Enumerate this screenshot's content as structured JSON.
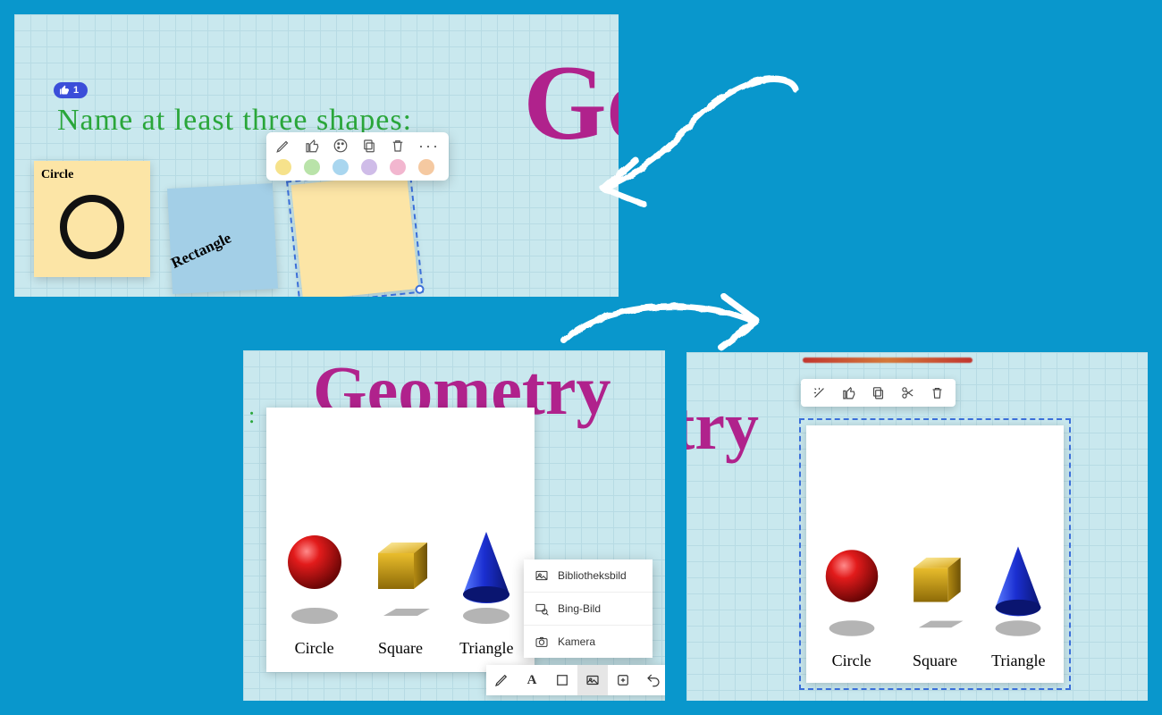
{
  "panel1": {
    "like_count": "1",
    "prompt": "Name at least three shapes:",
    "title_fragment": "Ge",
    "notes": {
      "circle_label": "Circle",
      "rectangle_label": "Rectangle"
    },
    "context_toolbar": {
      "pen_icon": "pen-icon",
      "like_icon": "thumbs-up-icon",
      "palette_icon": "palette-icon",
      "copy_icon": "copy-icon",
      "delete_icon": "trash-icon",
      "more_icon": "more-icon",
      "swatches": [
        "#f6e28b",
        "#b9e3a9",
        "#a9d6ef",
        "#cfbce8",
        "#f2b6cf",
        "#f5c9a1"
      ]
    }
  },
  "panel2": {
    "title": "Geometry",
    "trailing": ":",
    "shape_labels": {
      "circle": "Circle",
      "square": "Square",
      "triangle": "Triangle"
    },
    "image_menu": {
      "library": "Bibliotheksbild",
      "bing": "Bing-Bild",
      "camera": "Kamera"
    },
    "bottom_toolbar": {
      "pen": "pen-icon",
      "text": "A",
      "note": "note-icon",
      "image": "image-icon",
      "add": "plus-icon",
      "undo": "undo-icon"
    }
  },
  "panel3": {
    "title_fragment": "try",
    "shape_labels": {
      "circle": "Circle",
      "square": "Square",
      "triangle": "Triangle"
    },
    "context_toolbar": {
      "wand": "magic-wand-icon",
      "like": "thumbs-up-icon",
      "copy": "copy-icon",
      "cut": "scissors-icon",
      "delete": "trash-icon"
    }
  }
}
